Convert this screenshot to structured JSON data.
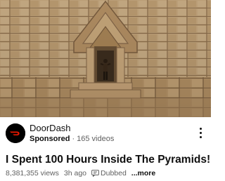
{
  "thumbnail": {
    "subject": "person-standing-at-pyramid-entrance"
  },
  "channel": {
    "name": "DoorDash",
    "sponsored_label": "Sponsored",
    "separator": "·",
    "videos": "165 videos",
    "avatar_icon": "doordash-logo-icon",
    "brand_color": "#eb1700"
  },
  "video": {
    "title": "I Spent 100 Hours Inside The Pyramids!",
    "views": "8,381,355 views",
    "age": "3h ago",
    "dubbed_label": "Dubbed",
    "more_label": "...more"
  },
  "menu_icon": "more-vert-icon"
}
